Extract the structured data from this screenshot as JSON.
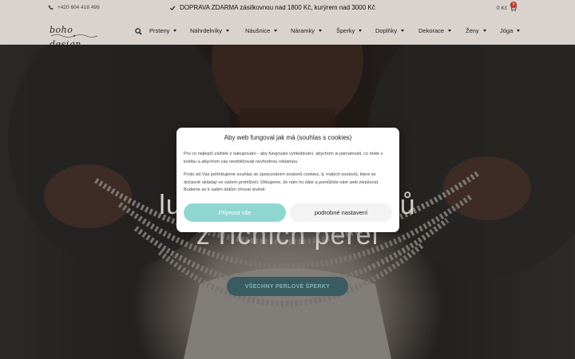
{
  "topbar": {
    "phone": "+420 604 418 499",
    "shipping": "DOPRAVA ZDARMA zásilkovnou nad 1800 Kč, kurýrem nad 3000 Kč",
    "cart_total": "0 Kč",
    "cart_count": "0"
  },
  "nav": {
    "logo": "boho design",
    "items": [
      {
        "label": "Prsteny"
      },
      {
        "label": "Náhrdelníky"
      },
      {
        "label": "Náušnice"
      },
      {
        "label": "Náramky"
      },
      {
        "label": "Šperky"
      },
      {
        "label": "Doplňky"
      },
      {
        "label": "Dekorace"
      },
      {
        "label": "Ženy"
      },
      {
        "label": "Jóga"
      }
    ]
  },
  "hero": {
    "title_line1": "luxusní sada šperků",
    "title_line2": "z říčních perel",
    "button": "VŠECHNY PERLOVÉ ŠPERKY"
  },
  "cookie": {
    "title": "Aby web fungoval jak má (souhlas s cookies)",
    "paragraph1": "Pro co nejlepší zážitek z nakupování - aby fungovalo vyhledávání, abychom si pamatovali, co máte v košíku a abychom vás neobtěžovali nevhodnou reklamou.",
    "paragraph2": "Proto od Vás potřebujeme souhlas se zpracováním souborů cookies, tj. malých souborů, které se dočasně ukládají ve vašem prohlížeči. Děkujeme, že nám ho dáte a pomůžete nám web zlepšovat. Budeme se k vašim datům chovat slušně.",
    "accept": "Přijmout vše",
    "settings": "podrobné nastavení"
  },
  "colors": {
    "topbar_bg": "#d9d2cd",
    "accept_btn": "#8fd6d1",
    "cart_badge": "#c0302a",
    "hero_btn": "#3a5b60"
  }
}
